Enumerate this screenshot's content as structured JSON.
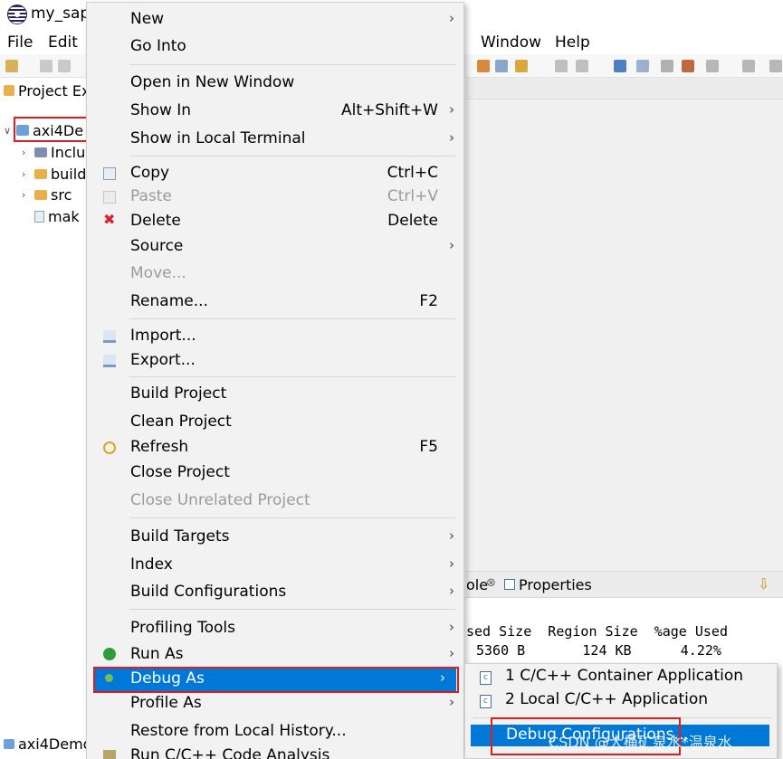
{
  "window": {
    "title": "my_sapp"
  },
  "menubar": {
    "file": "File",
    "edit": "Edit",
    "window": "Window",
    "help": "Help"
  },
  "explorer": {
    "tab_label": "Project Ex",
    "project": "axi4De",
    "items": [
      "Inclu",
      "build",
      "src",
      "mak"
    ]
  },
  "bottom_tab": "axi4Demo",
  "console": {
    "tab1": "ole",
    "tab2": "Properties",
    "header": "sed Size  Region Size  %age Used",
    "row": "5360 B       124 KB      4.22%"
  },
  "context_menu": {
    "new": "New",
    "go_into": "Go Into",
    "open_new_window": "Open in New Window",
    "show_in": "Show In",
    "show_in_accel": "Alt+Shift+W",
    "show_local_terminal": "Show in Local Terminal",
    "copy": "Copy",
    "copy_accel": "Ctrl+C",
    "paste": "Paste",
    "paste_accel": "Ctrl+V",
    "delete": "Delete",
    "delete_accel": "Delete",
    "source": "Source",
    "move": "Move...",
    "rename": "Rename...",
    "rename_accel": "F2",
    "import": "Import...",
    "export": "Export...",
    "build_project": "Build Project",
    "clean_project": "Clean Project",
    "refresh": "Refresh",
    "refresh_accel": "F5",
    "close_project": "Close Project",
    "close_unrelated": "Close Unrelated Project",
    "build_targets": "Build Targets",
    "index": "Index",
    "build_configurations": "Build Configurations",
    "profiling_tools": "Profiling Tools",
    "run_as": "Run As",
    "debug_as": "Debug As",
    "profile_as": "Profile As",
    "restore_history": "Restore from Local History...",
    "run_cpp_analysis": "Run C/C++ Code Analysis"
  },
  "submenu": {
    "item1": "1 C/C++ Container Application",
    "item2": "2 Local C/C++ Application",
    "item3": "Debug Configurations..."
  },
  "watermark": "CSDN @大桶矿泉水*温泉水",
  "colors": {
    "highlight": "#0078d7",
    "annotation_box": "#e11c1c"
  }
}
